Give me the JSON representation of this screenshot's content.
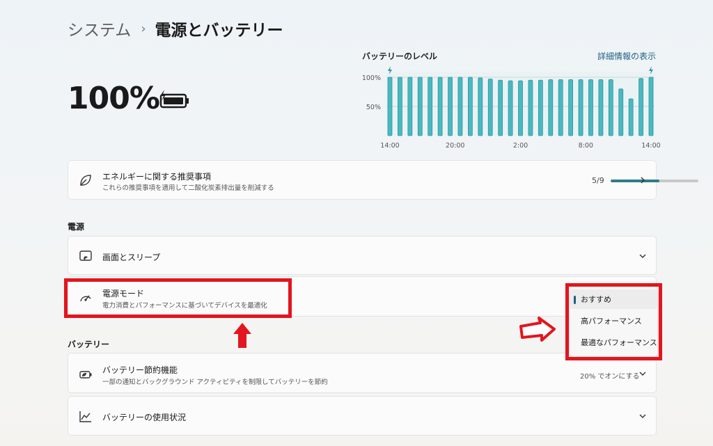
{
  "breadcrumb": {
    "parent": "システム",
    "separator": "›",
    "current": "電源とバッテリー"
  },
  "battery": {
    "level_text": "100%",
    "icon": "battery-charging-icon"
  },
  "chart_data": {
    "type": "bar",
    "title": "バッテリーのレベル",
    "link": "詳細情報の表示",
    "y_tick_labels": [
      "100%",
      "50%"
    ],
    "yticks": [
      100,
      50
    ],
    "ylim": [
      0,
      100
    ],
    "x_tick_labels": [
      "14:00",
      "20:00",
      "2:00",
      "8:00",
      "14:00"
    ],
    "values": [
      100,
      100,
      100,
      100,
      100,
      100,
      100,
      100,
      100,
      99,
      97,
      95,
      94,
      94,
      95,
      95,
      96,
      96,
      96,
      96,
      96,
      96,
      96,
      80,
      63,
      98,
      100
    ],
    "charging_markers": [
      0,
      26
    ],
    "bar_color": "#4ab8c0",
    "grid": true
  },
  "recommendations": {
    "title": "エネルギーに関する推奨事項",
    "subtitle": "これらの推奨事項を適用して二酸化炭素排出量を削減する",
    "count_text": "5/9",
    "progress": 0.556,
    "icon": "leaf-icon"
  },
  "power_section": {
    "heading": "電源",
    "screen_sleep": {
      "title": "画面とスリープ",
      "icon": "screen-sleep-icon"
    },
    "power_mode": {
      "title": "電源モード",
      "subtitle": "電力消費とパフォーマンスに基づいてデバイスを最適化",
      "icon": "power-mode-gauge-icon"
    }
  },
  "power_mode_dropdown": {
    "options": [
      "おすすめ",
      "高パフォーマンス",
      "最適なパフォーマンス"
    ],
    "selected": "おすすめ"
  },
  "battery_section": {
    "heading": "バッテリー",
    "saver": {
      "title": "バッテリー節約機能",
      "subtitle": "一部の通知とバックグラウンド アクティビティを制限してバッテリーを節約",
      "value": "20% でオンにする",
      "icon": "battery-saver-icon"
    },
    "usage": {
      "title": "バッテリーの使用状況",
      "icon": "usage-chart-icon"
    }
  },
  "annotations": {
    "highlight_color": "#e3151e"
  }
}
